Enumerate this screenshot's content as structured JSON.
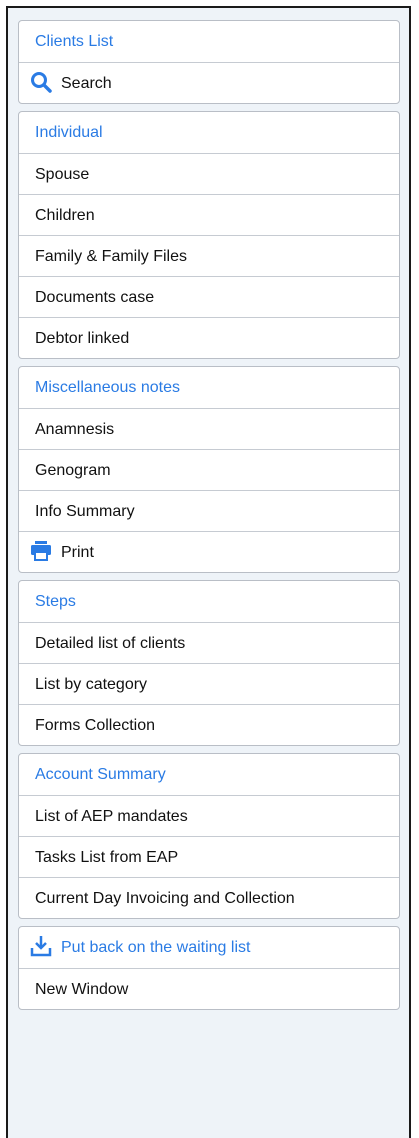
{
  "groups": {
    "clients": {
      "header": "Clients List",
      "items": [
        {
          "label": "Search",
          "icon": "search-icon"
        }
      ]
    },
    "individual": {
      "header": "Individual",
      "items": [
        {
          "label": "Spouse"
        },
        {
          "label": "Children"
        },
        {
          "label": "Family & Family Files"
        },
        {
          "label": "Documents case"
        },
        {
          "label": "Debtor linked"
        }
      ]
    },
    "misc": {
      "header": "Miscellaneous notes",
      "items": [
        {
          "label": "Anamnesis"
        },
        {
          "label": "Genogram"
        },
        {
          "label": "Info Summary"
        },
        {
          "label": "Print",
          "icon": "printer-icon"
        }
      ]
    },
    "steps": {
      "header": "Steps",
      "items": [
        {
          "label": "Detailed list of clients"
        },
        {
          "label": "List by category"
        },
        {
          "label": "Forms Collection"
        }
      ]
    },
    "account": {
      "header": "Account Summary",
      "items": [
        {
          "label": "List of AEP mandates"
        },
        {
          "label": "Tasks List from EAP"
        },
        {
          "label": "Current Day Invoicing and Collection"
        }
      ]
    },
    "waiting": {
      "items": [
        {
          "label": "Put back on the waiting list",
          "icon": "download-tray-icon"
        },
        {
          "label": "New Window"
        }
      ]
    }
  },
  "colors": {
    "accent": "#2a7be4",
    "panel_bg": "#eef3f8",
    "border": "#b9bec6"
  }
}
